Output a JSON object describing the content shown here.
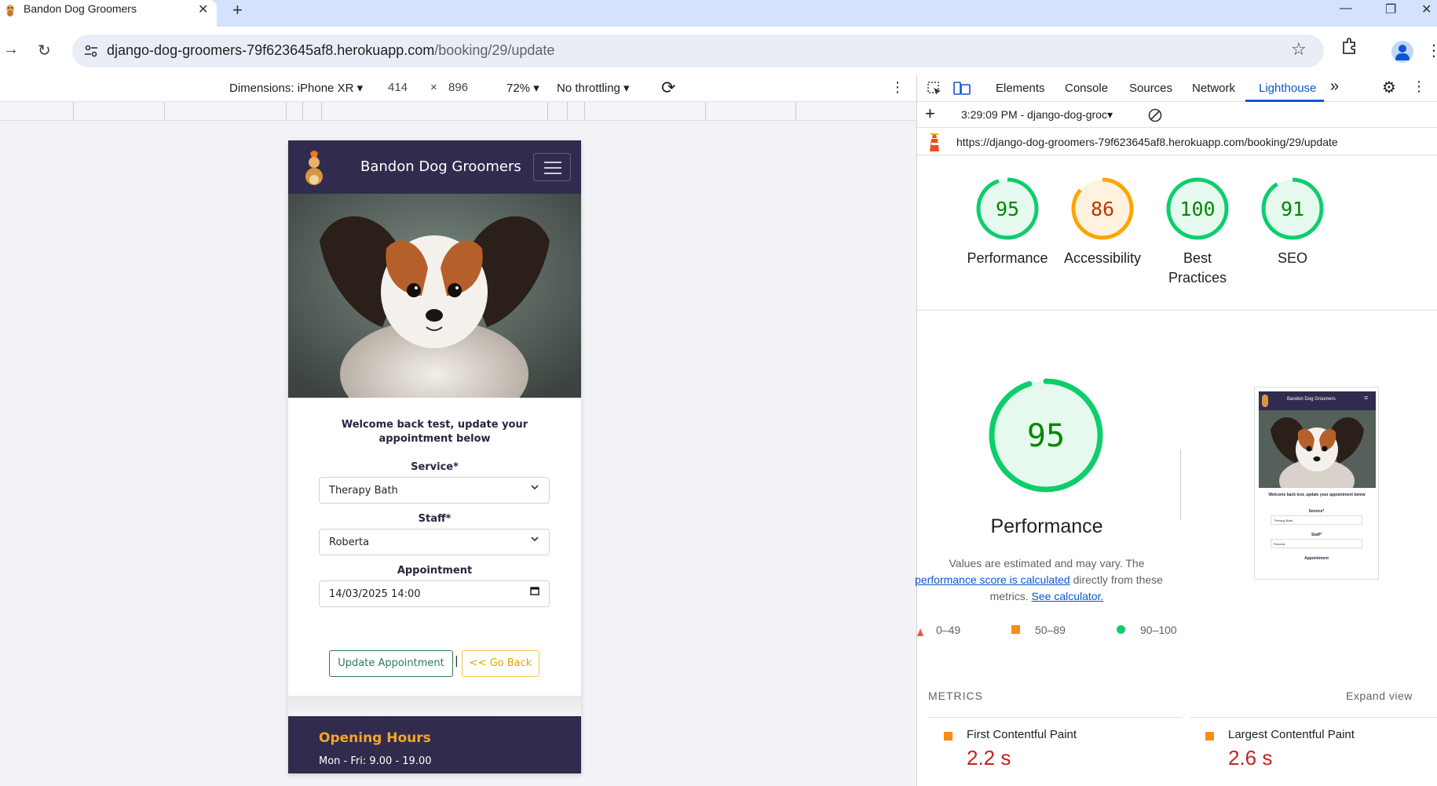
{
  "browser": {
    "tab_title": "Bandon Dog Groomers",
    "url_host": "django-dog-groomers-79f623645af8.herokuapp.com",
    "url_path": "/booking/29/update"
  },
  "device_toolbar": {
    "dimensions": "Dimensions: iPhone XR",
    "width": "414",
    "times": "×",
    "height": "896",
    "zoom": "72%",
    "throttling": "No throttling"
  },
  "site": {
    "brand": "Bandon Dog Groomers",
    "welcome_line1": "Welcome back test, update your",
    "welcome_line2": "appointment below",
    "service_label": "Service*",
    "service_value": "Therapy Bath",
    "staff_label": "Staff*",
    "staff_value": "Roberta",
    "appointment_label": "Appointment",
    "appointment_value": "14/03/2025 14:00",
    "update_button": "Update Appointment",
    "separator": "|",
    "back_button": "<< Go Back",
    "footer_heading": "Opening Hours",
    "footer_hours": "Mon - Fri: 9.00 - 19.00"
  },
  "devtools": {
    "tabs": [
      "Elements",
      "Console",
      "Sources",
      "Network",
      "Lighthouse"
    ],
    "active_tab": "Lighthouse",
    "report_select": "3:29:09 PM - django-dog-groc",
    "report_url": "https://django-dog-groomers-79f623645af8.herokuapp.com/booking/29/update",
    "scores": [
      {
        "value": 95,
        "label1": "Performance",
        "label2": "",
        "color": "#0cce6b",
        "text_color": "#008800"
      },
      {
        "value": 86,
        "label1": "Accessibility",
        "label2": "",
        "color": "#ffa400",
        "text_color": "#c33300"
      },
      {
        "value": 100,
        "label1": "Best",
        "label2": "Practices",
        "color": "#0cce6b",
        "text_color": "#008800"
      },
      {
        "value": 91,
        "label1": "SEO",
        "label2": "",
        "color": "#0cce6b",
        "text_color": "#008800"
      }
    ],
    "big_score": "95",
    "big_title": "Performance",
    "desc_line1": "Values are estimated and may vary. The",
    "desc_link1": "performance score is calculated",
    "desc_line2_rest": "directly from these",
    "desc_line3_pre": "metrics.",
    "desc_link2": "See calculator.",
    "legend": [
      "0–49",
      "50–89",
      "90–100"
    ],
    "metrics_heading": "METRICS",
    "expand_view": "Expand view",
    "metrics": [
      {
        "name": "First Contentful Paint",
        "value": "2.2 s"
      },
      {
        "name": "Largest Contentful Paint",
        "value": "2.6 s"
      }
    ],
    "thumb": {
      "brand": "Bandon Dog Groomers",
      "welcome": "Welcome back test, update your appointment below",
      "service": "Service*",
      "service_value": "Therapy Bath",
      "staff": "Staff*",
      "staff_value": "Roberta",
      "appointment": "Appointment"
    }
  },
  "colors": {
    "navy": "#312c4d",
    "accent_blue": "#0b57d0",
    "pass_green": "#0cce6b",
    "average_orange": "#ffa400",
    "fail_red": "#ff4e42"
  }
}
